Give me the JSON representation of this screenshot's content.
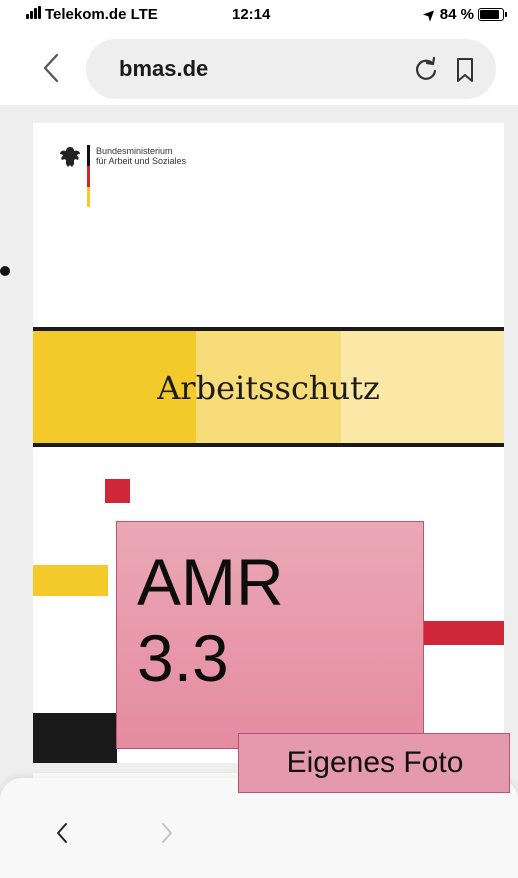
{
  "status_bar": {
    "carrier": "Telekom.de LTE",
    "time": "12:14",
    "battery": "84 %",
    "battery_level": 0.84
  },
  "browser": {
    "url": "bmas.de",
    "icons": [
      "back-icon",
      "reload-icon",
      "bookmark-icon"
    ]
  },
  "document": {
    "ministry_line1": "Bundesministerium",
    "ministry_line2": "für Arbeit und Soziales",
    "title": "Arbeitsschutz",
    "colors": {
      "yellow_dark": "#f3ca2a",
      "yellow_mid": "#f8dc7a",
      "yellow_light": "#fbe8a6",
      "red": "#d02639",
      "black": "#1a1a1a"
    }
  },
  "overlay": {
    "label_line1": "AMR",
    "label_line2": "3.3",
    "photo_caption": "Eigenes Foto"
  },
  "toolbar": {
    "icons": [
      "back-arrow-icon",
      "forward-arrow-icon"
    ]
  }
}
